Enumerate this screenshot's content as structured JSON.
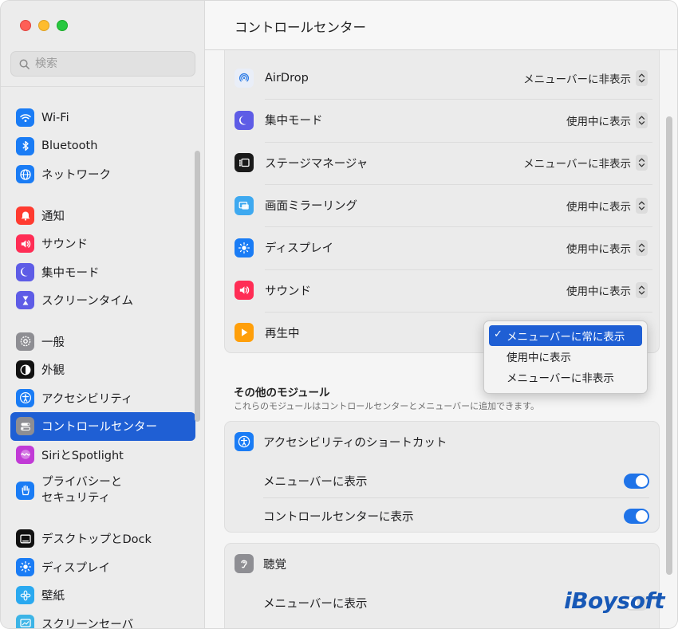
{
  "window": {
    "title": "コントロールセンター"
  },
  "search": {
    "placeholder": "検索"
  },
  "sidebar": {
    "groups": [
      [
        {
          "label": "Wi-Fi",
          "icon": "wifi-icon",
          "color": "#1a7cf5"
        },
        {
          "label": "Bluetooth",
          "icon": "bluetooth-icon",
          "color": "#1a7cf5"
        },
        {
          "label": "ネットワーク",
          "icon": "globe-icon",
          "color": "#1a7cf5"
        }
      ],
      [
        {
          "label": "通知",
          "icon": "bell-icon",
          "color": "#ff3b30"
        },
        {
          "label": "サウンド",
          "icon": "speaker-icon",
          "color": "#ff2d55"
        },
        {
          "label": "集中モード",
          "icon": "moon-icon",
          "color": "#5e5ce6"
        },
        {
          "label": "スクリーンタイム",
          "icon": "hourglass-icon",
          "color": "#5e5ce6"
        }
      ],
      [
        {
          "label": "一般",
          "icon": "gear-icon",
          "color": "#8e8e93"
        },
        {
          "label": "外観",
          "icon": "appearance-icon",
          "color": "#111111"
        },
        {
          "label": "アクセシビリティ",
          "icon": "accessibility-icon",
          "color": "#1a7cf5"
        },
        {
          "label": "コントロールセンター",
          "icon": "control-center-icon",
          "color": "#8e8e93",
          "selected": true
        },
        {
          "label": "SiriとSpotlight",
          "icon": "siri-icon",
          "color": "#c13ad6"
        },
        {
          "label": "プライバシーと\nセキュリティ",
          "icon": "hand-icon",
          "color": "#1a7cf5"
        }
      ],
      [
        {
          "label": "デスクトップとDock",
          "icon": "dock-icon",
          "color": "#111111"
        },
        {
          "label": "ディスプレイ",
          "icon": "sun-icon",
          "color": "#1a7cf5"
        },
        {
          "label": "壁紙",
          "icon": "flower-icon",
          "color": "#2aa9f0"
        },
        {
          "label": "スクリーンセーバ",
          "icon": "screensaver-icon",
          "color": "#3cb4e6"
        }
      ]
    ]
  },
  "modules": [
    {
      "label": "AirDrop",
      "icon": "airdrop-icon",
      "value": "メニューバーに非表示"
    },
    {
      "label": "集中モード",
      "icon": "moon-icon",
      "value": "使用中に表示"
    },
    {
      "label": "ステージマネージャ",
      "icon": "stage-manager-icon",
      "value": "メニューバーに非表示"
    },
    {
      "label": "画面ミラーリング",
      "icon": "screen-mirroring-icon",
      "value": "使用中に表示"
    },
    {
      "label": "ディスプレイ",
      "icon": "sun-icon",
      "value": "使用中に表示"
    },
    {
      "label": "サウンド",
      "icon": "speaker-icon",
      "value": "使用中に表示"
    },
    {
      "label": "再生中",
      "icon": "play-icon",
      "value": "メニューバーに常に表示"
    }
  ],
  "popup": {
    "options": [
      "メニューバーに常に表示",
      "使用中に表示",
      "メニューバーに非表示"
    ],
    "selected_index": 0,
    "check": "✓"
  },
  "other": {
    "title": "その他のモジュール",
    "subtitle": "これらのモジュールはコントロールセンターとメニューバーに追加できます。"
  },
  "accessibility_shortcut": {
    "title": "アクセシビリティのショートカット",
    "rows": [
      {
        "label": "メニューバーに表示",
        "on": true
      },
      {
        "label": "コントロールセンターに表示",
        "on": true
      }
    ]
  },
  "hearing": {
    "title": "聴覚",
    "rows": [
      {
        "label": "メニューバーに表示",
        "on": false
      }
    ]
  },
  "watermark": "iBoysoft"
}
